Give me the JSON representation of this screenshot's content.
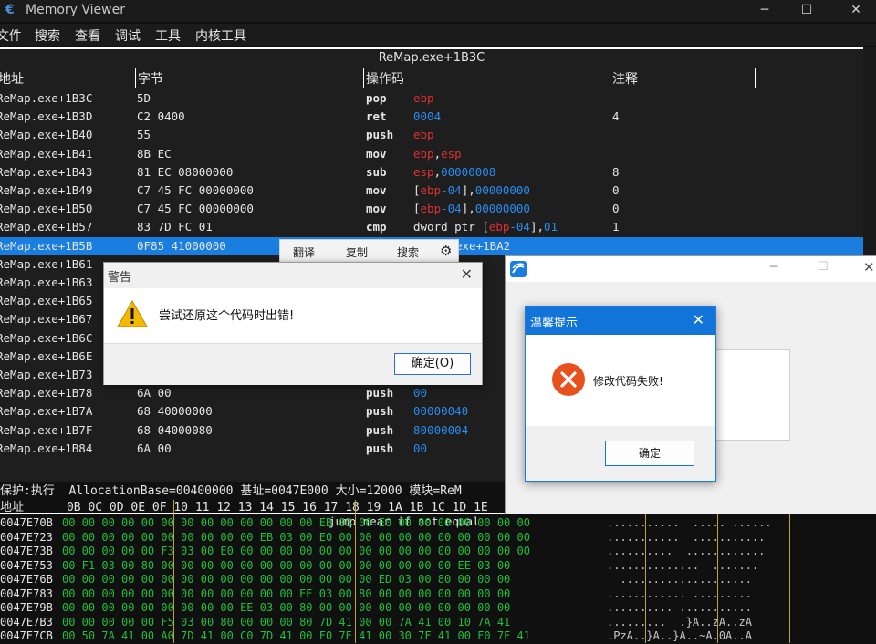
{
  "window": {
    "title": "Memory Viewer"
  },
  "menu": [
    "文件",
    "搜索",
    "查看",
    "调试",
    "工具",
    "内核工具"
  ],
  "disasm": {
    "header": "ReMap.exe+1B3C",
    "columns": [
      "地址",
      "字节",
      "操作码",
      "注释"
    ],
    "rows": [
      {
        "addr": "ReMap.exe+1B3C",
        "bytes": "5D",
        "op": "pop",
        "args": [
          {
            "t": "ebp",
            "c": "reg"
          }
        ],
        "comment": ""
      },
      {
        "addr": "ReMap.exe+1B3D",
        "bytes": "C2 0400",
        "op": "ret",
        "args": [
          {
            "t": "0004",
            "c": "num"
          }
        ],
        "comment": "4"
      },
      {
        "addr": "ReMap.exe+1B40",
        "bytes": "55",
        "op": "push",
        "args": [
          {
            "t": "ebp",
            "c": "reg"
          }
        ],
        "comment": ""
      },
      {
        "addr": "ReMap.exe+1B41",
        "bytes": "8B EC",
        "op": "mov",
        "args": [
          {
            "t": "ebp",
            "c": "reg"
          },
          {
            "t": ",",
            "c": ""
          },
          {
            "t": "esp",
            "c": "reg"
          }
        ],
        "comment": ""
      },
      {
        "addr": "ReMap.exe+1B43",
        "bytes": "81 EC 08000000",
        "op": "sub",
        "args": [
          {
            "t": "esp",
            "c": "reg"
          },
          {
            "t": ",",
            "c": ""
          },
          {
            "t": "00000008",
            "c": "num"
          }
        ],
        "comment": "8"
      },
      {
        "addr": "ReMap.exe+1B49",
        "bytes": "C7 45 FC 00000000",
        "op": "mov",
        "args": [
          {
            "t": "[",
            "c": ""
          },
          {
            "t": "ebp",
            "c": "reg"
          },
          {
            "t": "-04",
            "c": "num"
          },
          {
            "t": "],",
            "c": ""
          },
          {
            "t": "00000000",
            "c": "num"
          }
        ],
        "comment": "0"
      },
      {
        "addr": "ReMap.exe+1B50",
        "bytes": "C7 45 FC 00000000",
        "op": "mov",
        "args": [
          {
            "t": "[",
            "c": ""
          },
          {
            "t": "ebp",
            "c": "reg"
          },
          {
            "t": "-04",
            "c": "num"
          },
          {
            "t": "],",
            "c": ""
          },
          {
            "t": "00000000",
            "c": "num"
          }
        ],
        "comment": "0"
      },
      {
        "addr": "ReMap.exe+1B57",
        "bytes": "83 7D FC 01",
        "op": "cmp",
        "args": [
          {
            "t": "dword ptr [",
            "c": ""
          },
          {
            "t": "ebp",
            "c": "reg"
          },
          {
            "t": "-04",
            "c": "num"
          },
          {
            "t": "],",
            "c": ""
          },
          {
            "t": "01",
            "c": "num"
          }
        ],
        "comment": "1"
      },
      {
        "addr": "ReMap.exe+1B5B",
        "bytes": "0F85 41000000",
        "op": "",
        "args": [
          {
            "t": "exe+1BA2",
            "c": "num"
          }
        ],
        "comment": "",
        "selected": true
      },
      {
        "addr": "ReMap.exe+1B61",
        "bytes": "",
        "op": "",
        "args": [],
        "comment": ""
      },
      {
        "addr": "ReMap.exe+1B63",
        "bytes": "",
        "op": "",
        "args": [],
        "comment": ""
      },
      {
        "addr": "ReMap.exe+1B65",
        "bytes": "",
        "op": "",
        "args": [],
        "comment": ""
      },
      {
        "addr": "ReMap.exe+1B67",
        "bytes": "",
        "op": "",
        "args": [],
        "comment": ""
      },
      {
        "addr": "ReMap.exe+1B6C",
        "bytes": "",
        "op": "",
        "args": [],
        "comment": ""
      },
      {
        "addr": "ReMap.exe+1B6E",
        "bytes": "",
        "op": "",
        "args": [],
        "comment": ""
      },
      {
        "addr": "ReMap.exe+1B73",
        "bytes": "",
        "op": "",
        "args": [],
        "comment": ""
      },
      {
        "addr": "ReMap.exe+1B78",
        "bytes": "6A 00",
        "op": "push",
        "args": [
          {
            "t": "00",
            "c": "num"
          }
        ],
        "comment": ""
      },
      {
        "addr": "ReMap.exe+1B7A",
        "bytes": "68 40000000",
        "op": "push",
        "args": [
          {
            "t": "00000040",
            "c": "num"
          }
        ],
        "comment": ""
      },
      {
        "addr": "ReMap.exe+1B7F",
        "bytes": "68 04000080",
        "op": "push",
        "args": [
          {
            "t": "80000004",
            "c": "num"
          }
        ],
        "comment": ""
      },
      {
        "addr": "ReMap.exe+1B84",
        "bytes": "6A 00",
        "op": "push",
        "args": [
          {
            "t": "00",
            "c": "num"
          }
        ],
        "comment": ""
      }
    ],
    "status": "jump near if not equal"
  },
  "hex": {
    "info": "保护:执行  AllocationBase=00400000 基址=0047E000 大小=12000 模块=ReM",
    "header": "地址      0B 0C 0D 0E 0F 10 11 12 13 14 15 16 17 18 19 1A 1B 1C 1D 1E",
    "rows": [
      {
        "a": "0047E70B",
        "b": "00 00 00 00 00 00 00 00 00 00 00 00 00 EB 03 00 E0 00 00 00 00 00 00 00",
        "c": "...........  ..... ......"
      },
      {
        "a": "0047E723",
        "b": "00 00 00 00 00 00 00 00 00 00 EB 03 00 E0 00 00 00 00 00 00 00 00 00 00",
        "c": "...........  ..........."
      },
      {
        "a": "0047E73B",
        "b": "00 00 00 00 00 F3 03 00 E0 00 00 00 00 00 00 00 00 00 00 00 00 00 00 00",
        "c": "..........  ............"
      },
      {
        "a": "0047E753",
        "b": "00 F1 03 00 80 00 00 00 00 00 00 00 00 00 00 00 00 00 00 00 EE 03 00",
        "c": "..............  ......."
      },
      {
        "a": "0047E76B",
        "b": "00 00 00 00 00 00 00 00 00 00 00 00 00 00 00 00 ED 03 00 80 00 00 00",
        "c": "  ...................."
      },
      {
        "a": "0047E783",
        "b": "00 00 00 00 00 00 00 00 00 00 00 00 EE 03 00 80 00 00 00 00 00 00 00",
        "c": "............ ........."
      },
      {
        "a": "0047E79B",
        "b": "00 00 00 00 00 00 00 00 00 EE 03 00 80 00 00 00 00 00 00 00 00 00 00",
        "c": ".......... ..........."
      },
      {
        "a": "0047E7B3",
        "b": "00 00 00 00 00 F5 03 00 80 00 00 00 80 7D 41 00 00 7A 41 00 10 7A 41",
        "c": ".........  .}A..zA..zA"
      },
      {
        "a": "0047E7CB",
        "b": "00 50 7A 41 00 A0 7D 41 00 C0 7D 41 00 F0 7E 41 00 30 7F 41 00 F0 7F 41",
        "c": ".PzA..}A..}A..~A.0A..A"
      }
    ]
  },
  "context_toolbar": {
    "translate": "翻译",
    "copy": "复制",
    "search": "搜索"
  },
  "warning_dialog": {
    "title": "警告",
    "message": "尝试还原这个代码时出错!",
    "ok": "确定(O)"
  },
  "tip_dialog": {
    "title": "温馨提示",
    "message": "修改代码失败!",
    "ok": "确定"
  },
  "colors": {
    "selection": "#1a7ee0",
    "register": "#e03030",
    "number": "#2a8cf0",
    "hex_bytes": "#1fbf3a"
  }
}
